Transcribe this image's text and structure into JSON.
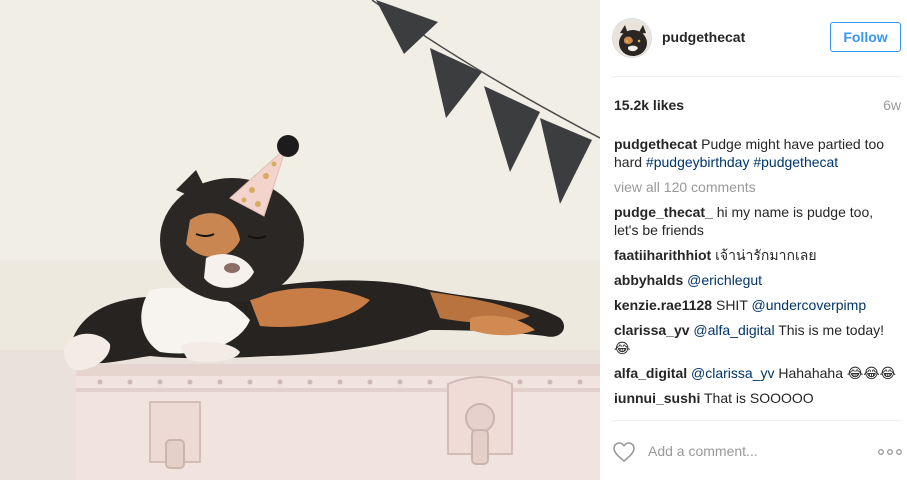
{
  "post": {
    "username": "pudgethecat",
    "follow_label": "Follow",
    "likes": "15.2k likes",
    "age": "6w",
    "caption": {
      "user": "pudgethecat",
      "text": "Pudge might have partied too hard",
      "tags": [
        "#pudgeybirthday",
        "#pudgethecat"
      ]
    },
    "view_all": "view all 120 comments",
    "comments": [
      {
        "user": "pudge_thecat_",
        "text": "hi my name is pudge too, let's be friends",
        "tag": ""
      },
      {
        "user": "faatiiharithhiot",
        "text": "เจ้าน่ารักมากเลย",
        "tag": ""
      },
      {
        "user": "abbyhalds",
        "text": "",
        "tag": "@erichlegut"
      },
      {
        "user": "kenzie.rae1128",
        "text": "SHIT",
        "tag": "@undercoverpimp"
      },
      {
        "user": "clarissa_yv",
        "text": "This is me today! 😂",
        "tag": "@alfa_digital"
      },
      {
        "user": "alfa_digital",
        "text": "Hahahaha 😂😂😂",
        "tag": "@clarissa_yv"
      },
      {
        "user": "iunnui_sushi",
        "text": "That is SOOOOO",
        "tag": ""
      }
    ],
    "add_comment_placeholder": "Add a comment...",
    "icons": {
      "like": "heart-icon",
      "options": "more-options-icon"
    },
    "colors": {
      "accent": "#3897f0",
      "link": "#003569",
      "muted": "#999999"
    }
  }
}
